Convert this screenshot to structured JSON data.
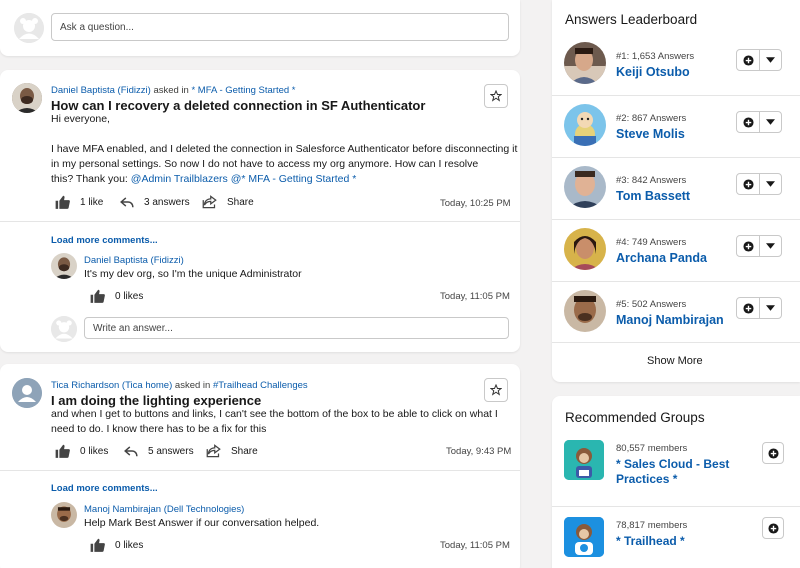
{
  "ask": {
    "placeholder": "Ask a question..."
  },
  "posts": [
    {
      "author": "Daniel Baptista (Fidizzi)",
      "asked_in_label": "asked in",
      "topic": "* MFA - Getting Started *",
      "title": "How can I recovery a deleted connection in SF Authenticator",
      "body_line1": "Hi everyone,",
      "body_line2": "I have MFA enabled, and I deleted the connection in Salesforce Authenticator before disconnecting it",
      "body_line3_prefix": "in my personal settings. So now I do not have to access my org anymore.   How can I resolve",
      "body_line4_prefix": "this?  Thank you:  ",
      "mention1": "@Admin Trailblazers",
      "mention2": "@* MFA - Getting Started *",
      "likes": "1 like",
      "answers": "3 answers",
      "share": "Share",
      "time": "Today, 10:25 PM",
      "load_more": "Load more comments...",
      "comment_author": "Daniel Baptista (Fidizzi)",
      "comment_text": "It's my dev org, so I'm the unique Administrator",
      "comment_likes": "0 likes",
      "comment_time": "Today, 11:05 PM",
      "answer_placeholder": "Write an answer..."
    },
    {
      "author": "Tica Richardson (Tica home)",
      "asked_in_label": "asked in",
      "topic": "#Trailhead Challenges",
      "title": "I am doing the lighting experience",
      "body_line1": "and when I get to buttons and links, I can't see the bottom of the box to be able to click on what I",
      "body_line2": "need to do.  I know there has to be a fix for this",
      "likes": "0 likes",
      "answers": "5 answers",
      "share": "Share",
      "time": "Today, 9:43 PM",
      "load_more": "Load more comments...",
      "comment_author": "Manoj Nambirajan (Dell Technologies)",
      "comment_text": "Help Mark Best Answer if our conversation helped.",
      "comment_likes": "0 likes",
      "comment_time": "Today, 11:05 PM"
    }
  ],
  "leaderboard": {
    "title": "Answers Leaderboard",
    "entries": [
      {
        "rank": "#1: 1,653 Answers",
        "name": "Keiji Otsubo"
      },
      {
        "rank": "#2: 867 Answers",
        "name": "Steve Molis"
      },
      {
        "rank": "#3: 842 Answers",
        "name": "Tom Bassett"
      },
      {
        "rank": "#4: 749 Answers",
        "name": "Archana Panda"
      },
      {
        "rank": "#5: 502 Answers",
        "name": "Manoj Nambirajan"
      }
    ],
    "show_more": "Show More"
  },
  "groups": {
    "title": "Recommended Groups",
    "entries": [
      {
        "members": "80,557 members",
        "name_line1": "* Sales Cloud - Best",
        "name_line2": "Practices *"
      },
      {
        "members": "78,817 members",
        "name_line1": "* Trailhead *",
        "name_line2": ""
      }
    ]
  },
  "colors": {
    "link": "#0b5cab",
    "background": "#f3f2f2",
    "card": "#ffffff"
  }
}
